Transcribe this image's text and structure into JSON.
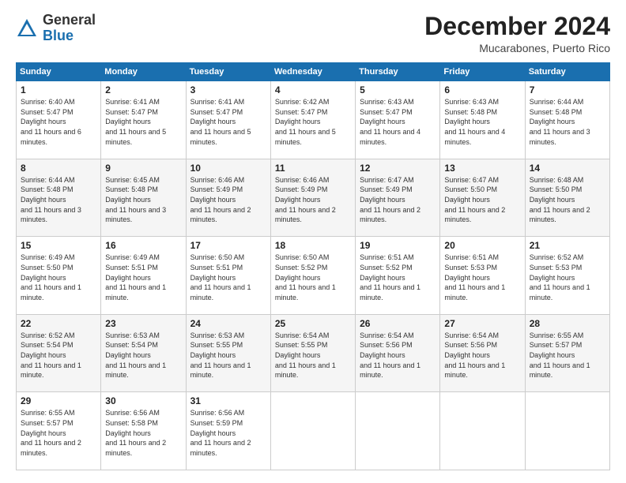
{
  "header": {
    "logo_general": "General",
    "logo_blue": "Blue",
    "month_title": "December 2024",
    "location": "Mucarabones, Puerto Rico"
  },
  "weekdays": [
    "Sunday",
    "Monday",
    "Tuesday",
    "Wednesday",
    "Thursday",
    "Friday",
    "Saturday"
  ],
  "weeks": [
    [
      {
        "day": "1",
        "sunrise": "6:40 AM",
        "sunset": "5:47 PM",
        "daylight": "11 hours and 6 minutes."
      },
      {
        "day": "2",
        "sunrise": "6:41 AM",
        "sunset": "5:47 PM",
        "daylight": "11 hours and 5 minutes."
      },
      {
        "day": "3",
        "sunrise": "6:41 AM",
        "sunset": "5:47 PM",
        "daylight": "11 hours and 5 minutes."
      },
      {
        "day": "4",
        "sunrise": "6:42 AM",
        "sunset": "5:47 PM",
        "daylight": "11 hours and 5 minutes."
      },
      {
        "day": "5",
        "sunrise": "6:43 AM",
        "sunset": "5:47 PM",
        "daylight": "11 hours and 4 minutes."
      },
      {
        "day": "6",
        "sunrise": "6:43 AM",
        "sunset": "5:48 PM",
        "daylight": "11 hours and 4 minutes."
      },
      {
        "day": "7",
        "sunrise": "6:44 AM",
        "sunset": "5:48 PM",
        "daylight": "11 hours and 3 minutes."
      }
    ],
    [
      {
        "day": "8",
        "sunrise": "6:44 AM",
        "sunset": "5:48 PM",
        "daylight": "11 hours and 3 minutes."
      },
      {
        "day": "9",
        "sunrise": "6:45 AM",
        "sunset": "5:48 PM",
        "daylight": "11 hours and 3 minutes."
      },
      {
        "day": "10",
        "sunrise": "6:46 AM",
        "sunset": "5:49 PM",
        "daylight": "11 hours and 2 minutes."
      },
      {
        "day": "11",
        "sunrise": "6:46 AM",
        "sunset": "5:49 PM",
        "daylight": "11 hours and 2 minutes."
      },
      {
        "day": "12",
        "sunrise": "6:47 AM",
        "sunset": "5:49 PM",
        "daylight": "11 hours and 2 minutes."
      },
      {
        "day": "13",
        "sunrise": "6:47 AM",
        "sunset": "5:50 PM",
        "daylight": "11 hours and 2 minutes."
      },
      {
        "day": "14",
        "sunrise": "6:48 AM",
        "sunset": "5:50 PM",
        "daylight": "11 hours and 2 minutes."
      }
    ],
    [
      {
        "day": "15",
        "sunrise": "6:49 AM",
        "sunset": "5:50 PM",
        "daylight": "11 hours and 1 minute."
      },
      {
        "day": "16",
        "sunrise": "6:49 AM",
        "sunset": "5:51 PM",
        "daylight": "11 hours and 1 minute."
      },
      {
        "day": "17",
        "sunrise": "6:50 AM",
        "sunset": "5:51 PM",
        "daylight": "11 hours and 1 minute."
      },
      {
        "day": "18",
        "sunrise": "6:50 AM",
        "sunset": "5:52 PM",
        "daylight": "11 hours and 1 minute."
      },
      {
        "day": "19",
        "sunrise": "6:51 AM",
        "sunset": "5:52 PM",
        "daylight": "11 hours and 1 minute."
      },
      {
        "day": "20",
        "sunrise": "6:51 AM",
        "sunset": "5:53 PM",
        "daylight": "11 hours and 1 minute."
      },
      {
        "day": "21",
        "sunrise": "6:52 AM",
        "sunset": "5:53 PM",
        "daylight": "11 hours and 1 minute."
      }
    ],
    [
      {
        "day": "22",
        "sunrise": "6:52 AM",
        "sunset": "5:54 PM",
        "daylight": "11 hours and 1 minute."
      },
      {
        "day": "23",
        "sunrise": "6:53 AM",
        "sunset": "5:54 PM",
        "daylight": "11 hours and 1 minute."
      },
      {
        "day": "24",
        "sunrise": "6:53 AM",
        "sunset": "5:55 PM",
        "daylight": "11 hours and 1 minute."
      },
      {
        "day": "25",
        "sunrise": "6:54 AM",
        "sunset": "5:55 PM",
        "daylight": "11 hours and 1 minute."
      },
      {
        "day": "26",
        "sunrise": "6:54 AM",
        "sunset": "5:56 PM",
        "daylight": "11 hours and 1 minute."
      },
      {
        "day": "27",
        "sunrise": "6:54 AM",
        "sunset": "5:56 PM",
        "daylight": "11 hours and 1 minute."
      },
      {
        "day": "28",
        "sunrise": "6:55 AM",
        "sunset": "5:57 PM",
        "daylight": "11 hours and 1 minute."
      }
    ],
    [
      {
        "day": "29",
        "sunrise": "6:55 AM",
        "sunset": "5:57 PM",
        "daylight": "11 hours and 2 minutes."
      },
      {
        "day": "30",
        "sunrise": "6:56 AM",
        "sunset": "5:58 PM",
        "daylight": "11 hours and 2 minutes."
      },
      {
        "day": "31",
        "sunrise": "6:56 AM",
        "sunset": "5:59 PM",
        "daylight": "11 hours and 2 minutes."
      },
      null,
      null,
      null,
      null
    ]
  ]
}
